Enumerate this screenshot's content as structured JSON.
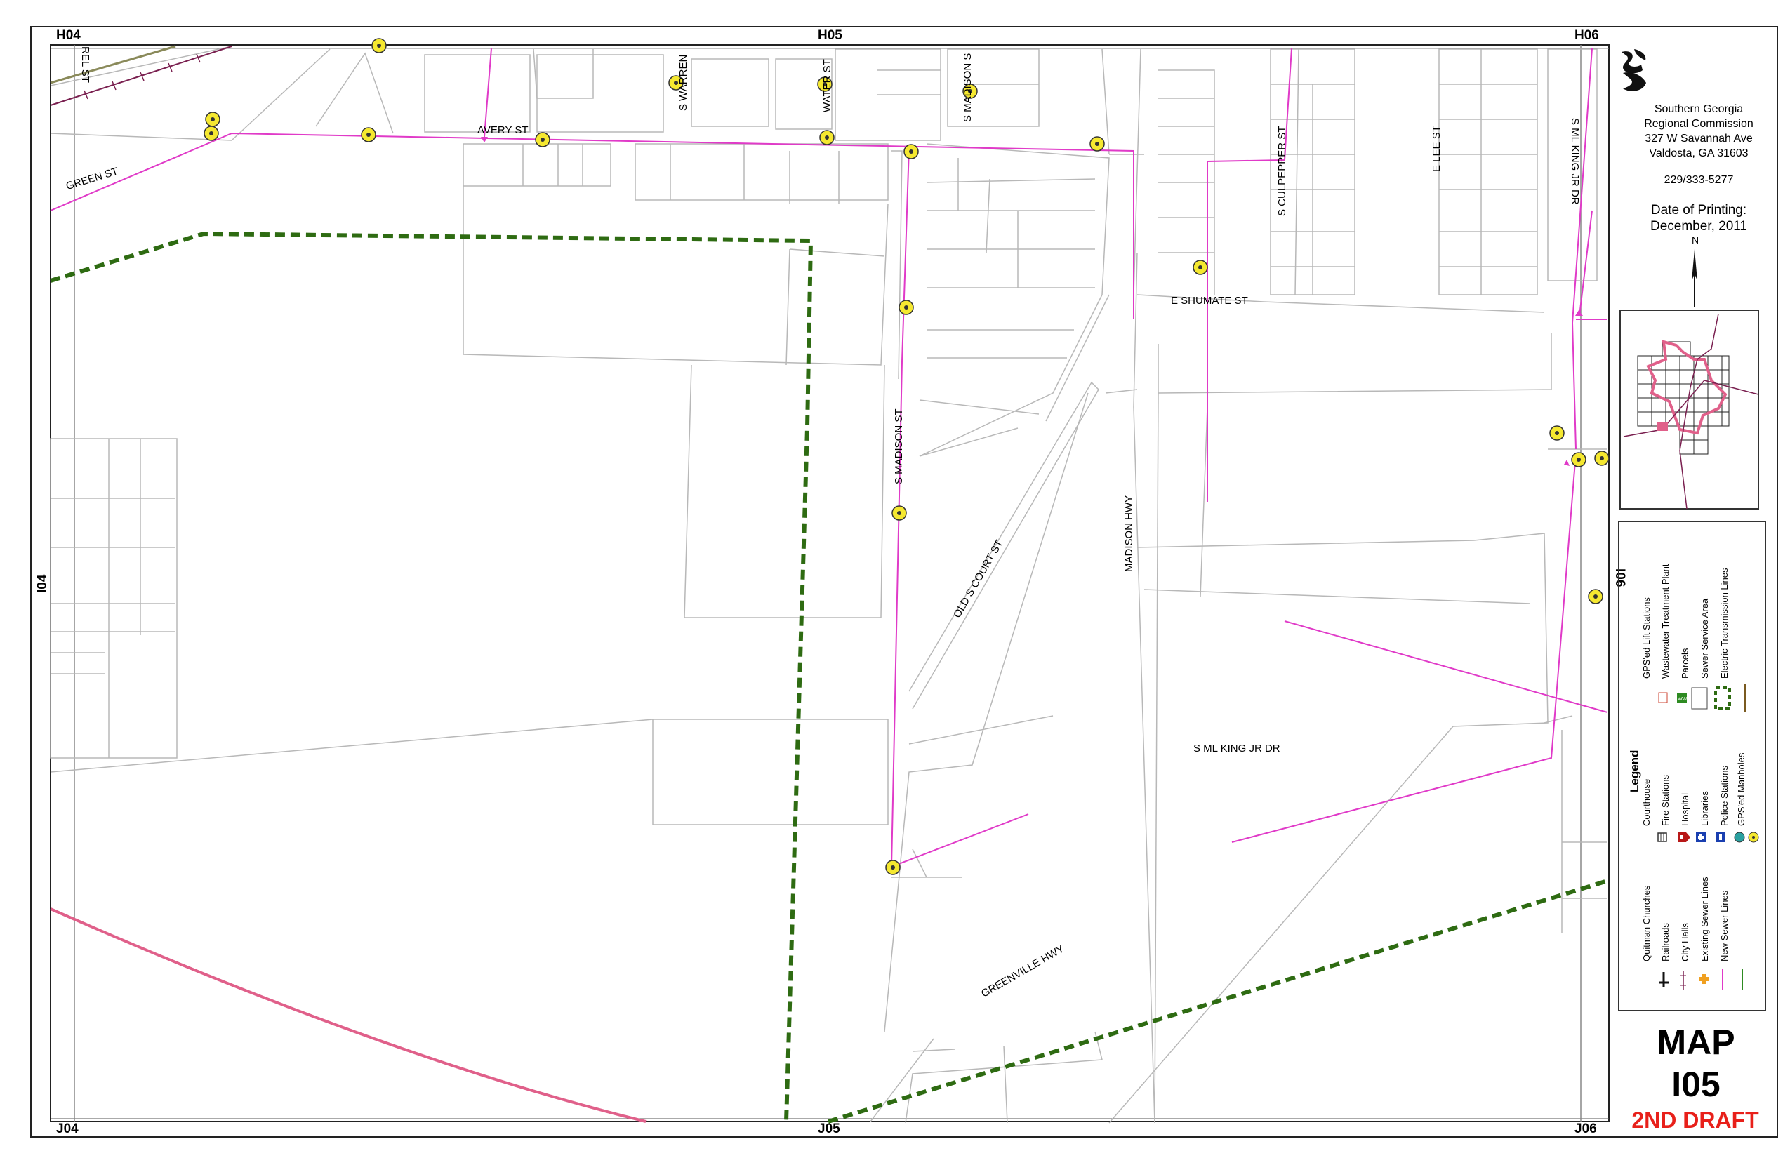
{
  "map": {
    "grid_labels": {
      "top_left": "H04",
      "top_center": "H05",
      "top_right": "H06",
      "bottom_left": "J04",
      "bottom_center": "J05",
      "bottom_right": "J06",
      "left": "I04",
      "right": "I06"
    },
    "streets": {
      "green": "GREEN ST",
      "avery": "AVERY ST",
      "rel": "REL ST",
      "warren": "S WARREN",
      "water": "WATER ST",
      "madison_top": "S MADISON S",
      "culpepper": "S CULPEPPER ST",
      "lee": "E LEE ST",
      "mlking_top": "S ML KING JR DR",
      "shumate": "E SHUMATE ST",
      "madison": "S MADISON ST",
      "old_court": "OLD S COURT ST",
      "madison_hwy": "MADISON HWY",
      "mlking": "S ML KING JR DR",
      "greenville": "GREENVILLE HWY"
    },
    "colors": {
      "sewer_existing": "#e03ac8",
      "sewer_service_area": "#2e6b12",
      "transmission": "#e0608a",
      "railroad": "#7a2050",
      "parcel": "#b8b8b8",
      "manhole": "#f5e830"
    }
  },
  "sidebar": {
    "logo_icon": "sgrc-logo-icon",
    "org_name": "Southern Georgia",
    "org_name2": "Regional Commission",
    "address1": "327 W Savannah Ave",
    "address2": "Valdosta, GA  31603",
    "phone": "229/333-5277",
    "date_label": "Date of Printing:",
    "date_value": "December, 2011",
    "north_label": "N",
    "map_label": "MAP",
    "map_id": "I05",
    "draft": "2ND DRAFT"
  },
  "legend": {
    "title": "Legend",
    "items": [
      {
        "label": "Quitman Churches",
        "icon": "church-icon"
      },
      {
        "label": "Railroads",
        "icon": "railroad-icon"
      },
      {
        "label": "City Halls",
        "icon": "city-hall-icon"
      },
      {
        "label": "Existing Sewer Lines",
        "icon": "existing-sewer-line-icon"
      },
      {
        "label": "New Sewer Lines",
        "icon": "new-sewer-line-icon"
      },
      {
        "label": "Courthouse",
        "icon": "courthouse-icon"
      },
      {
        "label": "Fire Stations",
        "icon": "fire-station-icon"
      },
      {
        "label": "Hospital",
        "icon": "hospital-icon"
      },
      {
        "label": "Libraries",
        "icon": "library-icon"
      },
      {
        "label": "Police Stations",
        "icon": "police-station-icon"
      },
      {
        "label": "GPS'ed Manholes",
        "icon": "manhole-icon"
      },
      {
        "label": "GPS'ed Lift Stations",
        "icon": "lift-station-icon"
      },
      {
        "label": "Wastewater Treatment Plant",
        "icon": "wwtp-icon"
      },
      {
        "label": "Parcels",
        "icon": "parcel-icon"
      },
      {
        "label": "Sewer Service Area",
        "icon": "sewer-service-area-icon"
      },
      {
        "label": "Electric Transmission Lines",
        "icon": "transmission-line-icon"
      }
    ]
  }
}
